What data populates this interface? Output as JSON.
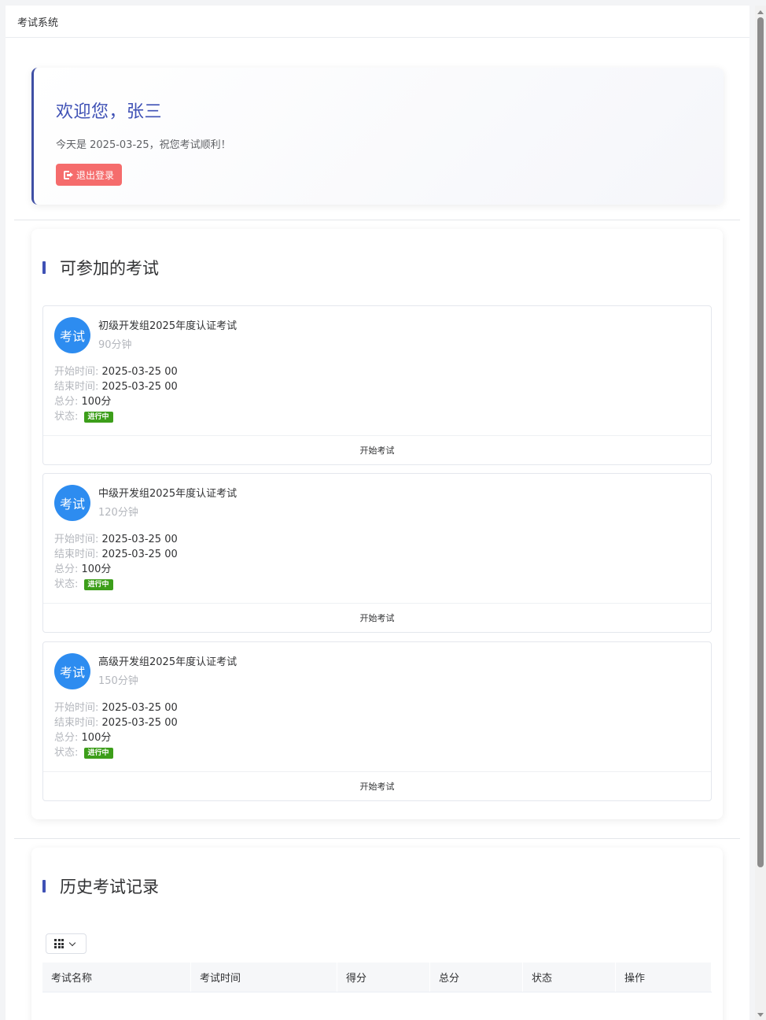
{
  "app": {
    "title": "考试系统"
  },
  "welcome": {
    "greeting": "欢迎您，张三",
    "date_text": "今天是 2025-03-25，祝您考试顺利！",
    "logout_label": "退出登录"
  },
  "available": {
    "title": "可参加的考试",
    "labels": {
      "start": "开始时间:",
      "end": "结束时间:",
      "total": "总分:",
      "status": "状态:"
    },
    "exams": [
      {
        "avatar": "考试",
        "name": "初级开发组2025年度认证考试",
        "duration": "90分钟",
        "start": "2025-03-25 00",
        "end": "2025-03-25 00",
        "total": "100分",
        "status": "进行中",
        "action": "开始考试"
      },
      {
        "avatar": "考试",
        "name": "中级开发组2025年度认证考试",
        "duration": "120分钟",
        "start": "2025-03-25 00",
        "end": "2025-03-25 00",
        "total": "100分",
        "status": "进行中",
        "action": "开始考试"
      },
      {
        "avatar": "考试",
        "name": "高级开发组2025年度认证考试",
        "duration": "150分钟",
        "start": "2025-03-25 00",
        "end": "2025-03-25 00",
        "total": "100分",
        "status": "进行中",
        "action": "开始考试"
      }
    ]
  },
  "history": {
    "title": "历史考试记录",
    "columns": [
      "考试名称",
      "考试时间",
      "得分",
      "总分",
      "状态",
      "操作"
    ]
  },
  "colors": {
    "accent": "#3f51b5",
    "danger": "#f56c6c",
    "avatar": "#2d8cf0",
    "success": "#3c9e1a"
  }
}
